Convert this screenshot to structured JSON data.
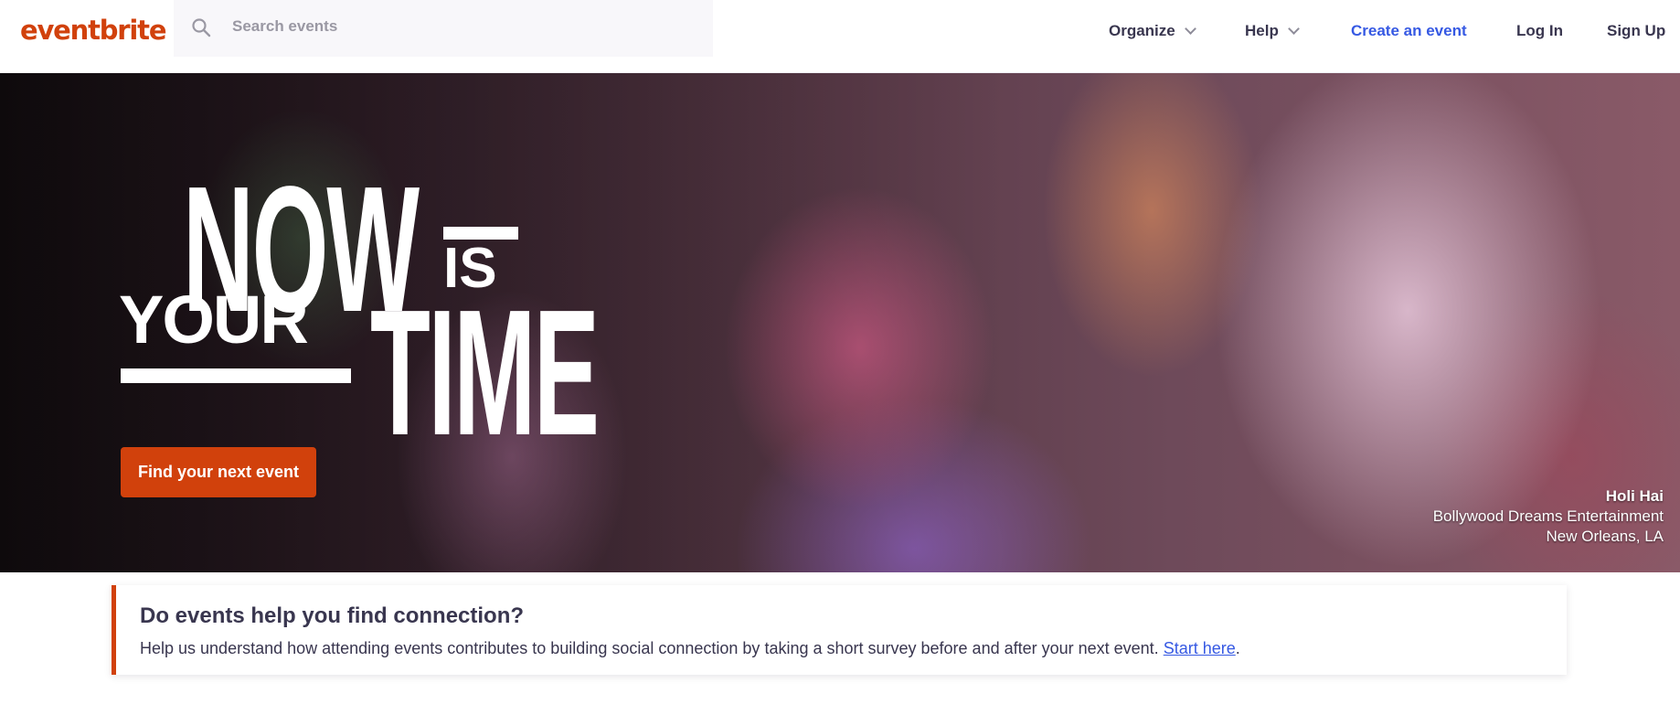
{
  "header": {
    "logo": "eventbrite",
    "search": {
      "placeholder": "Search events"
    },
    "nav": {
      "organize": "Organize",
      "help": "Help",
      "create": "Create an event",
      "login": "Log In",
      "signup": "Sign Up"
    }
  },
  "hero": {
    "headline": {
      "now": "NOW",
      "is": "IS",
      "your": "YOUR",
      "time": "TIME"
    },
    "cta": "Find your next event",
    "caption": {
      "title": "Holi Hai",
      "organizer": "Bollywood Dreams Entertainment",
      "location": "New Orleans, LA"
    }
  },
  "survey": {
    "title": "Do events help you find connection?",
    "body": "Help us understand how attending events contributes to building social connection by taking a short survey before and after your next event.",
    "link": "Start here",
    "suffix": "."
  },
  "colors": {
    "brand": "#d1410c",
    "link": "#3659e3",
    "text": "#39364f"
  }
}
